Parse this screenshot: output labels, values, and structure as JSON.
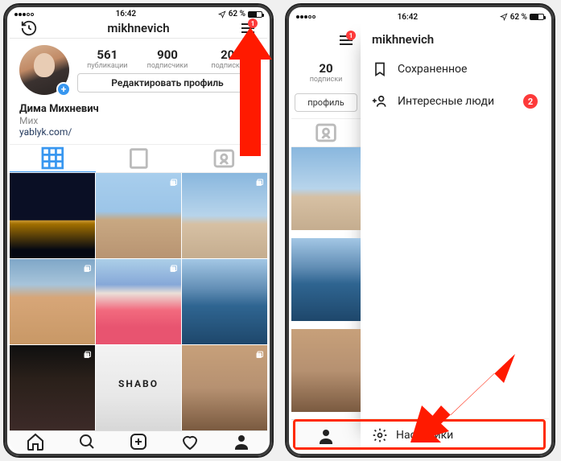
{
  "status": {
    "time": "16:42",
    "battery_pct": "62 %"
  },
  "left": {
    "title": "mikhnevich",
    "menu_badge": "1",
    "stats": [
      {
        "num": "561",
        "label": "публикации"
      },
      {
        "num": "900",
        "label": "подписчики"
      },
      {
        "num": "20",
        "label": "подписки"
      }
    ],
    "edit_profile": "Редактировать профиль",
    "bio": {
      "name": "Дима Михневич",
      "sub": "Мих",
      "link": "yablyk.com/"
    }
  },
  "right": {
    "menu_badge": "1",
    "mini_stat": {
      "num": "20",
      "label": "подписки"
    },
    "mini_btn": "профиль",
    "drawer": {
      "title": "mikhnevich",
      "items": [
        {
          "icon": "bookmark",
          "label": "Сохраненное"
        },
        {
          "icon": "add-person",
          "label": "Интересные люди",
          "badge": "2"
        }
      ],
      "settings": "Настройки"
    }
  }
}
